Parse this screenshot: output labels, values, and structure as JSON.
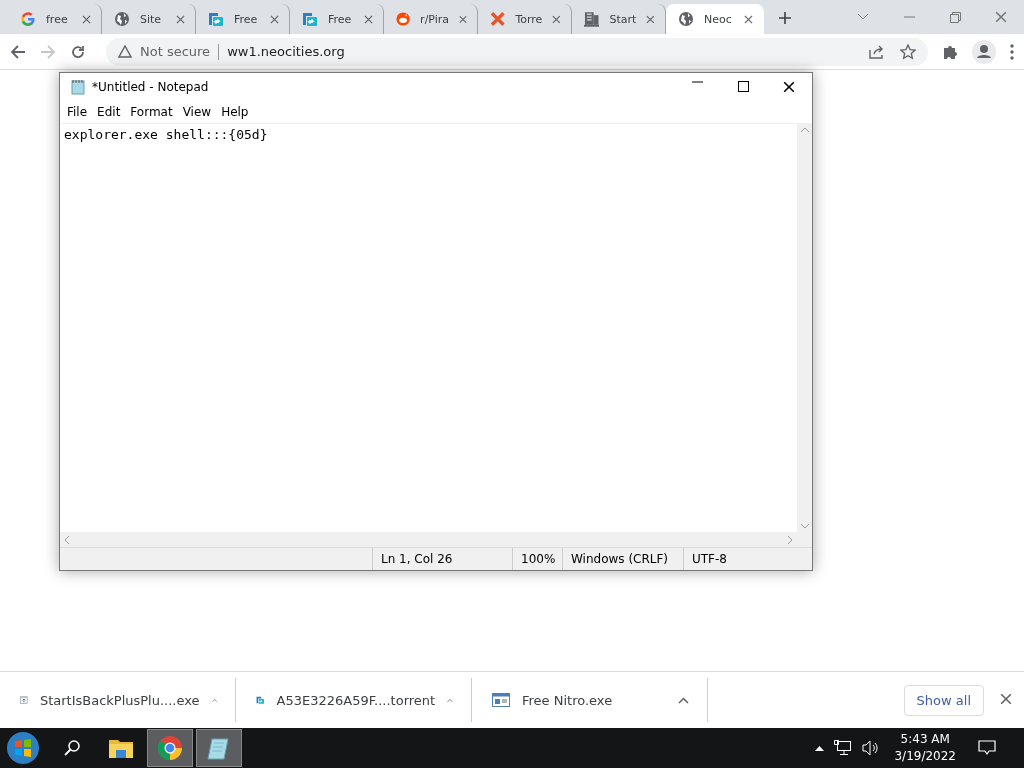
{
  "browser": {
    "tabs": [
      {
        "label": "free",
        "kind": "google",
        "selected": false
      },
      {
        "label": "Site",
        "kind": "globe",
        "selected": false
      },
      {
        "label": "Free",
        "kind": "torrent",
        "selected": false
      },
      {
        "label": "Free",
        "kind": "torrent",
        "selected": false
      },
      {
        "label": "r/Pira",
        "kind": "reddit",
        "selected": false
      },
      {
        "label": "Torre",
        "kind": "cross",
        "selected": false
      },
      {
        "label": "Start",
        "kind": "building",
        "selected": false
      },
      {
        "label": "Neoc",
        "kind": "globe",
        "selected": true
      }
    ],
    "address": {
      "security": "Not secure",
      "url": "ww1.neocities.org"
    }
  },
  "notepad": {
    "title": "*Untitled - Notepad",
    "menu": [
      "File",
      "Edit",
      "Format",
      "View",
      "Help"
    ],
    "text": "explorer.exe shell:::{05d}",
    "status": [
      "Ln 1, Col 26",
      "100%",
      "Windows (CRLF)",
      "UTF-8"
    ]
  },
  "downloads": {
    "items": [
      {
        "name": "StartIsBackPlusPlu....exe",
        "kind": "installer"
      },
      {
        "name": "A53E3226A59F....torrent",
        "kind": "torrent"
      },
      {
        "name": "Free Nitro.exe",
        "kind": "window"
      }
    ],
    "show_all": "Show all"
  },
  "taskbar": {
    "apps": [
      {
        "kind": "explorer",
        "active": false
      },
      {
        "kind": "chrome",
        "active": true
      },
      {
        "kind": "notepad",
        "active": true
      }
    ],
    "time": "5:43 AM",
    "date": "3/19/2022"
  }
}
